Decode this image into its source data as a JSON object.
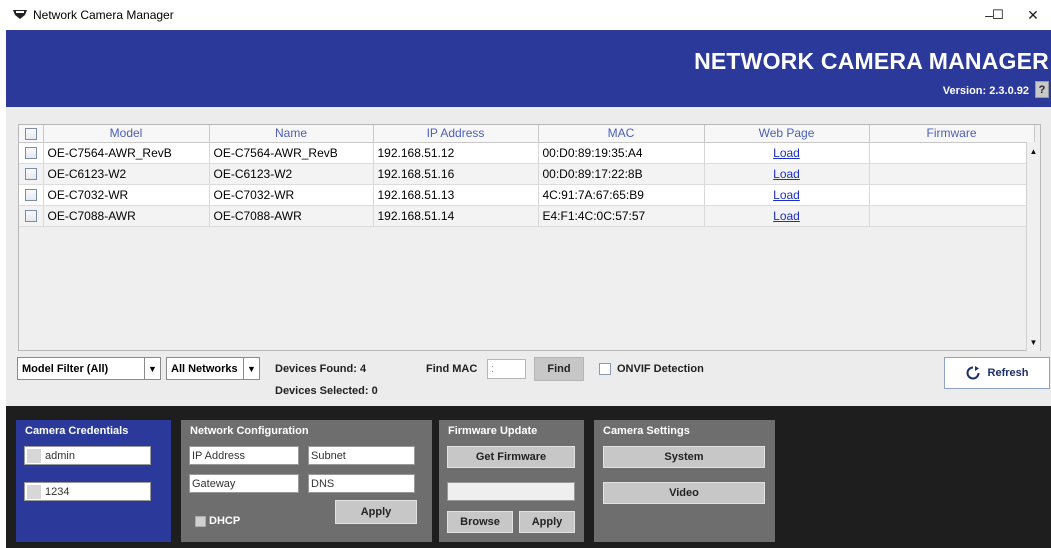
{
  "window": {
    "title": "Network Camera Manager",
    "minimize_glyph": "–",
    "maximize_glyph": "☐",
    "close_glyph": "✕"
  },
  "banner": {
    "app_name": "NETWORK CAMERA MANAGER",
    "version": "Version: 2.3.0.92",
    "help": "?"
  },
  "table": {
    "columns": [
      "Model",
      "Name",
      "IP Address",
      "MAC",
      "Web Page",
      "Firmware"
    ],
    "rows": [
      {
        "model": "OE-C7564-AWR_RevB",
        "name": "OE-C7564-AWR_RevB",
        "ip": "192.168.51.12",
        "mac": "00:D0:89:19:35:A4",
        "web": "Load",
        "firmware": ""
      },
      {
        "model": "OE-C6123-W2",
        "name": "OE-C6123-W2",
        "ip": "192.168.51.16",
        "mac": "00:D0:89:17:22:8B",
        "web": "Load",
        "firmware": ""
      },
      {
        "model": "OE-C7032-WR",
        "name": "OE-C7032-WR",
        "ip": "192.168.51.13",
        "mac": "4C:91:7A:67:65:B9",
        "web": "Load",
        "firmware": ""
      },
      {
        "model": "OE-C7088-AWR",
        "name": "OE-C7088-AWR",
        "ip": "192.168.51.14",
        "mac": "E4:F1:4C:0C:57:57",
        "web": "Load",
        "firmware": ""
      }
    ]
  },
  "controls": {
    "model_filter": "Model Filter (All)",
    "network_filter": "All Networks",
    "devices_found": "Devices Found: 4",
    "devices_selected": "Devices Selected: 0",
    "find_mac_label": "Find MAC",
    "find_mac_placeholder": ":",
    "find_button": "Find",
    "onvif_label": "ONVIF Detection",
    "refresh_button": "Refresh"
  },
  "credentials": {
    "title": "Camera Credentials",
    "username": "admin",
    "password": "1234"
  },
  "network_config": {
    "title": "Network Configuration",
    "ip_placeholder": "IP Address",
    "subnet_placeholder": "Subnet",
    "gateway_placeholder": "Gateway",
    "dns_placeholder": "DNS",
    "dhcp_label": "DHCP",
    "apply_button": "Apply"
  },
  "firmware_update": {
    "title": "Firmware Update",
    "get_button": "Get Firmware",
    "path_value": "",
    "browse_button": "Browse",
    "apply_button": "Apply"
  },
  "camera_settings": {
    "title": "Camera Settings",
    "system_button": "System",
    "video_button": "Video"
  },
  "colors": {
    "banner_blue": "#2b3a9a",
    "credentials_blue": "#2b3a9a",
    "panel_gray": "#6e6e6e",
    "bottom_dark": "#1e1e1e",
    "link_blue": "#1a2ecc",
    "header_text": "#4a5fb8"
  }
}
